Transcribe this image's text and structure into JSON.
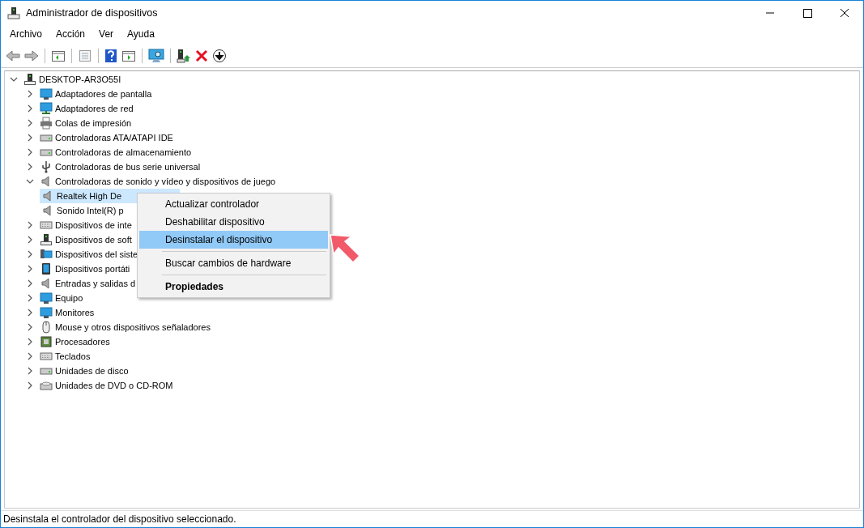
{
  "window": {
    "title": "Administrador de dispositivos"
  },
  "menu_bar": [
    "Archivo",
    "Acción",
    "Ver",
    "Ayuda"
  ],
  "tree": {
    "label": "DESKTOP-AR3O55I",
    "expanded": true,
    "children": [
      {
        "label": "Adaptadores de pantalla",
        "expanded": false
      },
      {
        "label": "Adaptadores de red",
        "expanded": false
      },
      {
        "label": "Colas de impresión",
        "expanded": false
      },
      {
        "label": "Controladoras ATA/ATAPI IDE",
        "expanded": false
      },
      {
        "label": "Controladoras de almacenamiento",
        "expanded": false
      },
      {
        "label": "Controladoras de bus serie universal",
        "expanded": false
      },
      {
        "label": "Controladoras de sonido y vídeo y dispositivos de juego",
        "expanded": true,
        "children": [
          {
            "label": "Realtek High De",
            "selected": true
          },
          {
            "label": "Sonido Intel(R) p",
            "selected": false
          }
        ]
      },
      {
        "label": "Dispositivos de inte",
        "expanded": false
      },
      {
        "label": "Dispositivos de soft",
        "expanded": false
      },
      {
        "label": "Dispositivos del siste",
        "expanded": false
      },
      {
        "label": "Dispositivos portáti",
        "expanded": false
      },
      {
        "label": "Entradas y salidas d",
        "expanded": false
      },
      {
        "label": "Equipo",
        "expanded": false
      },
      {
        "label": "Monitores",
        "expanded": false
      },
      {
        "label": "Mouse y otros dispositivos señaladores",
        "expanded": false
      },
      {
        "label": "Procesadores",
        "expanded": false
      },
      {
        "label": "Teclados",
        "expanded": false
      },
      {
        "label": "Unidades de disco",
        "expanded": false
      },
      {
        "label": "Unidades de DVD o CD-ROM",
        "expanded": false
      }
    ]
  },
  "context_menu": [
    {
      "kind": "item",
      "label": "Actualizar controlador",
      "selected": false,
      "default": false
    },
    {
      "kind": "item",
      "label": "Deshabilitar dispositivo",
      "selected": false,
      "default": false
    },
    {
      "kind": "item",
      "label": "Desinstalar el dispositivo",
      "selected": true,
      "default": false
    },
    {
      "kind": "separator"
    },
    {
      "kind": "item",
      "label": "Buscar cambios de hardware",
      "selected": false,
      "default": false
    },
    {
      "kind": "separator"
    },
    {
      "kind": "item",
      "label": "Propiedades",
      "selected": false,
      "default": true
    }
  ],
  "status_bar": "Desinstala el controlador del dispositivo seleccionado."
}
